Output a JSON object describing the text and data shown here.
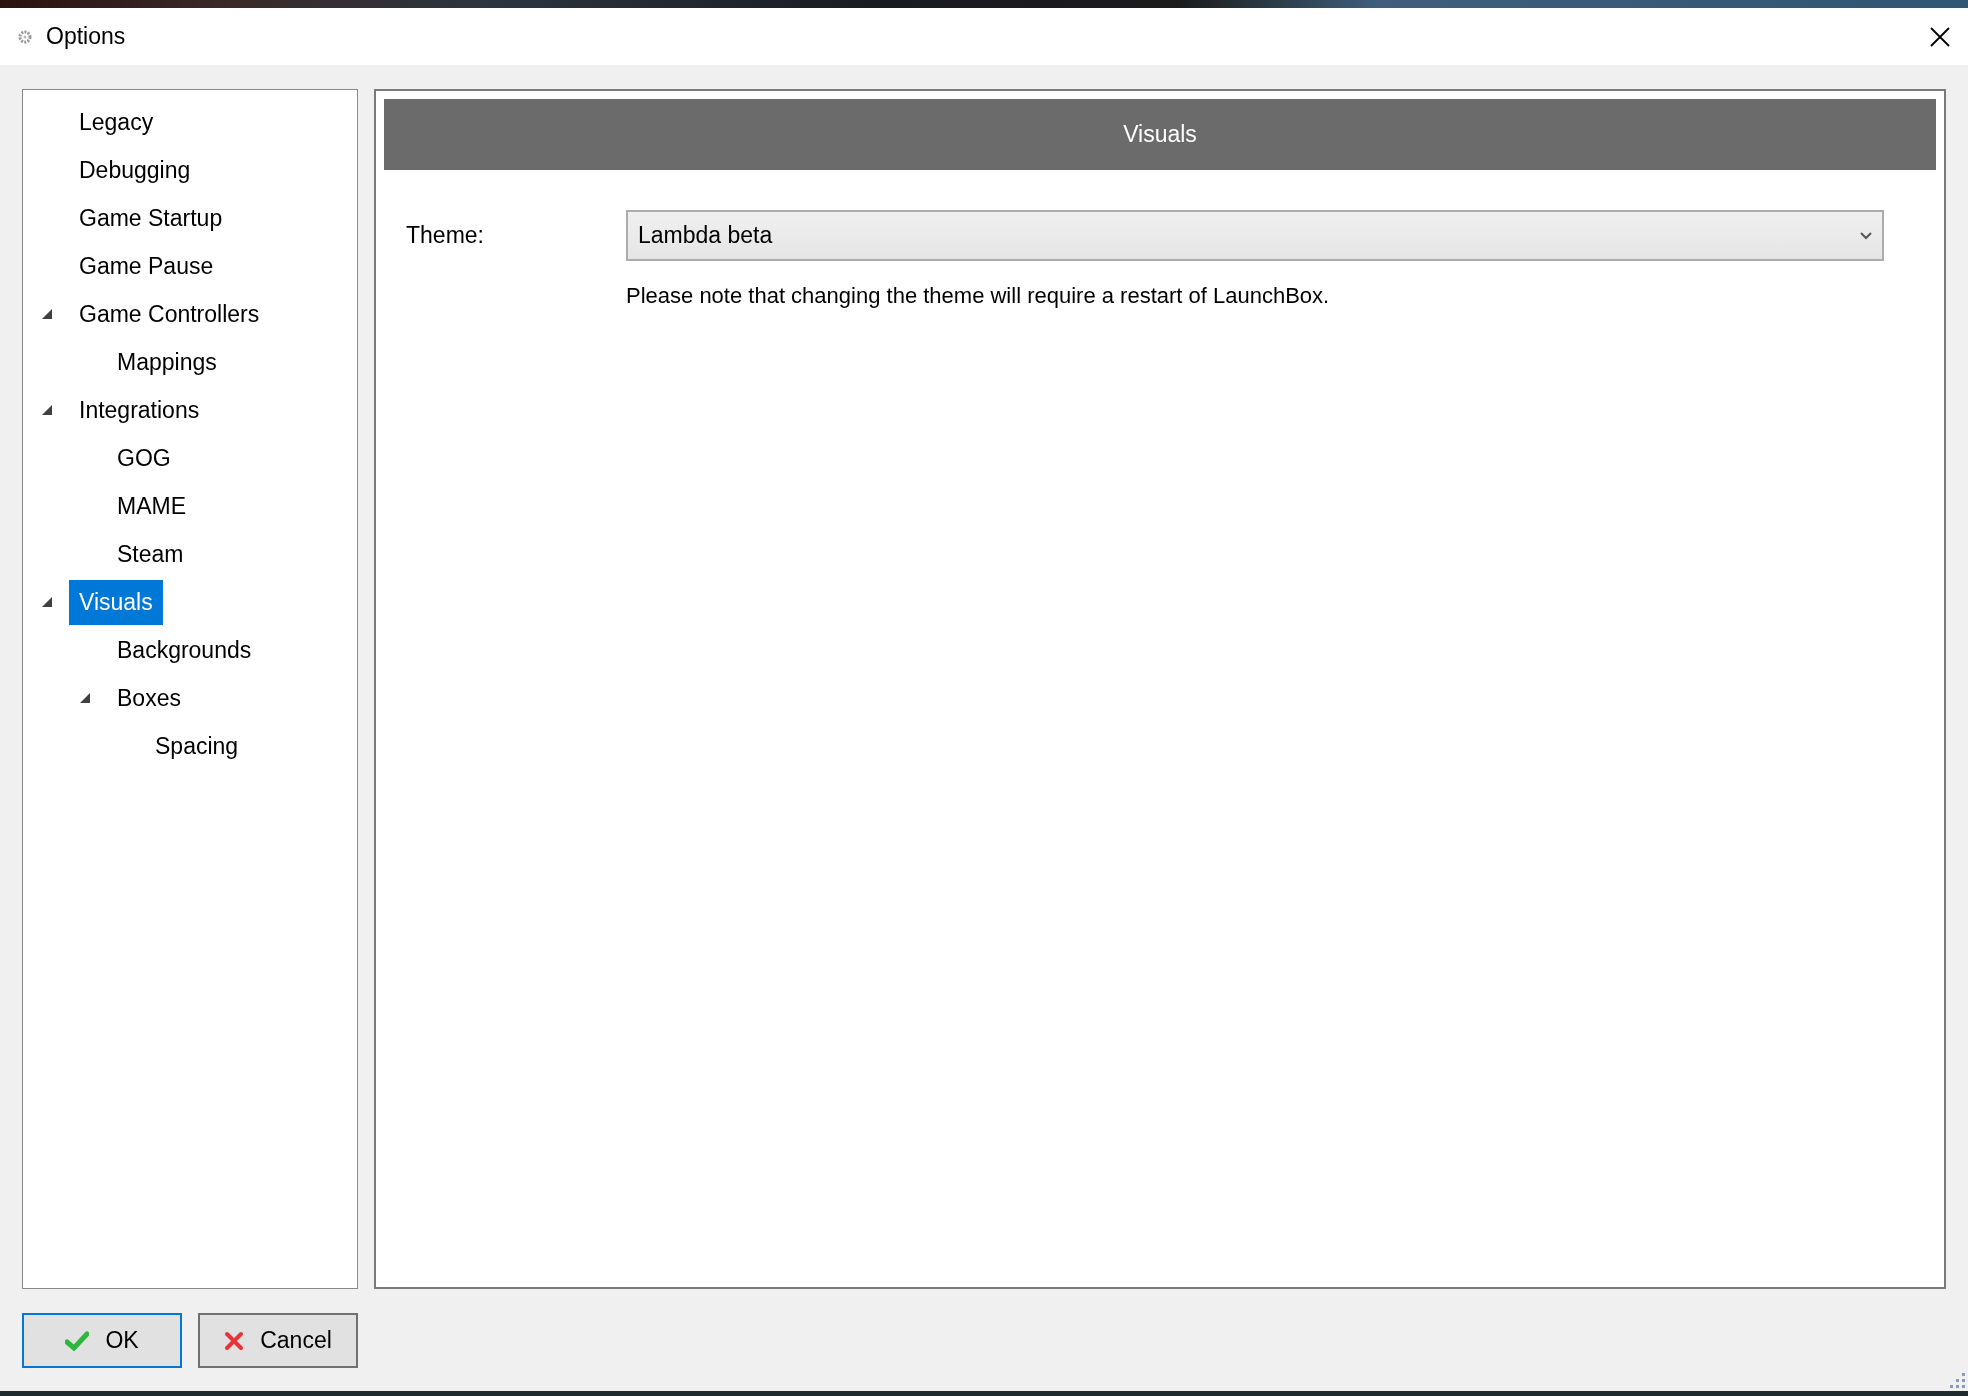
{
  "window": {
    "title": "Options"
  },
  "tree": [
    {
      "label": "Legacy",
      "selected": false
    },
    {
      "label": "Debugging",
      "selected": false
    },
    {
      "label": "Game Startup",
      "selected": false
    },
    {
      "label": "Game Pause",
      "selected": false
    },
    {
      "label": "Game Controllers",
      "selected": false,
      "expanded": true,
      "children": [
        {
          "label": "Mappings",
          "selected": false
        }
      ]
    },
    {
      "label": "Integrations",
      "selected": false,
      "expanded": true,
      "children": [
        {
          "label": "GOG",
          "selected": false
        },
        {
          "label": "MAME",
          "selected": false
        },
        {
          "label": "Steam",
          "selected": false
        }
      ]
    },
    {
      "label": "Visuals",
      "selected": true,
      "expanded": true,
      "children": [
        {
          "label": "Backgrounds",
          "selected": false
        },
        {
          "label": "Boxes",
          "selected": false,
          "expanded": true,
          "children": [
            {
              "label": "Spacing",
              "selected": false
            }
          ]
        }
      ]
    }
  ],
  "panel": {
    "title": "Visuals",
    "theme_label": "Theme:",
    "theme_value": "Lambda beta",
    "note": "Please note that changing the theme will require a restart of LaunchBox."
  },
  "buttons": [
    {
      "kind": "ok",
      "label": "OK",
      "focused": true
    },
    {
      "kind": "cancel",
      "label": "Cancel",
      "focused": false
    }
  ]
}
